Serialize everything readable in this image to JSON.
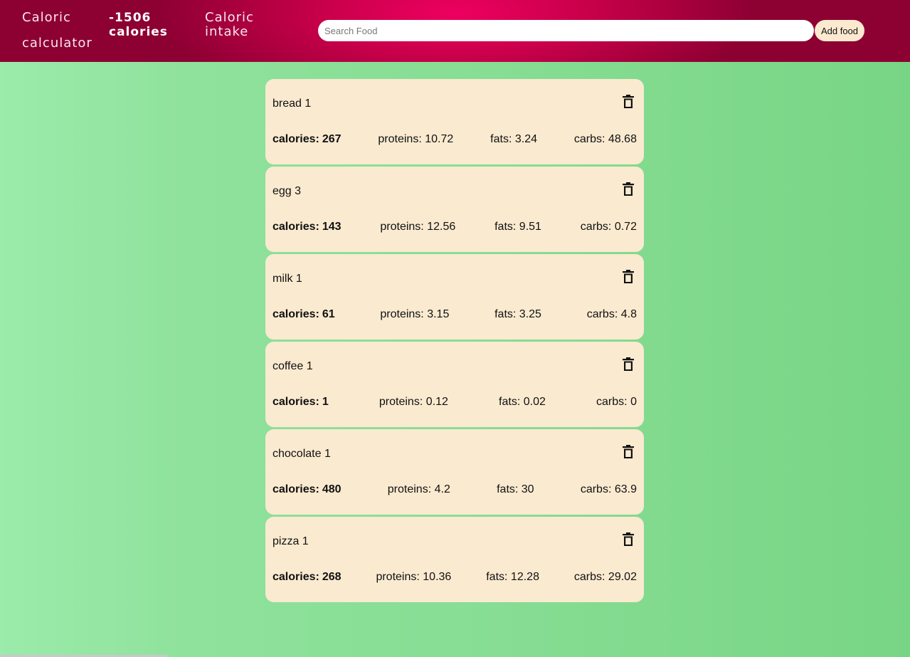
{
  "header": {
    "brand_line1": "Caloric",
    "brand_line2": "calculator",
    "total_value": "-1506",
    "total_unit": "calories",
    "intake_line1": "Caloric",
    "intake_line2": "intake",
    "search_placeholder": "Search Food",
    "search_value": "",
    "add_label": "Add food"
  },
  "labels": {
    "calories": "calories:",
    "proteins": "proteins:",
    "fats": "fats:",
    "carbs": "carbs:"
  },
  "foods": [
    {
      "name": "bread 1",
      "calories": "267",
      "proteins": "10.72",
      "fats": "3.24",
      "carbs": "48.68"
    },
    {
      "name": "egg 3",
      "calories": "143",
      "proteins": "12.56",
      "fats": "9.51",
      "carbs": "0.72"
    },
    {
      "name": "milk 1",
      "calories": "61",
      "proteins": "3.15",
      "fats": "3.25",
      "carbs": "4.8"
    },
    {
      "name": "coffee 1",
      "calories": "1",
      "proteins": "0.12",
      "fats": "0.02",
      "carbs": "0"
    },
    {
      "name": "chocolate 1",
      "calories": "480",
      "proteins": "4.2",
      "fats": "30",
      "carbs": "63.9"
    },
    {
      "name": "pizza 1",
      "calories": "268",
      "proteins": "10.36",
      "fats": "12.28",
      "carbs": "29.02"
    }
  ],
  "icons": {
    "delete": "trash-icon"
  },
  "colors": {
    "header_center": "#ee0060",
    "header_edge": "#8d0032",
    "card_bg": "#faead0",
    "page_bg": "#8fe29c"
  }
}
